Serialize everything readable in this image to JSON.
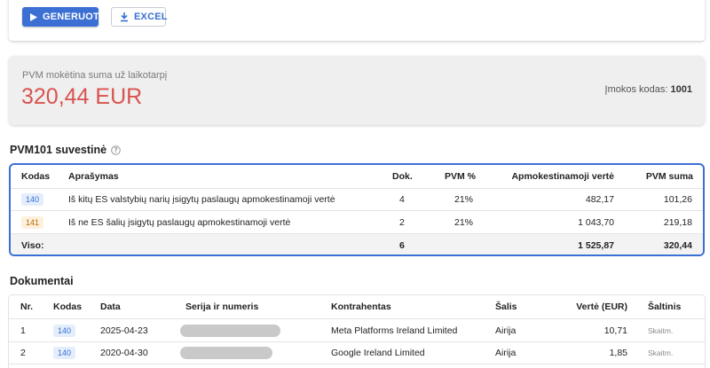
{
  "toolbar": {
    "generate_label": "GENERUOTI",
    "excel_label": "EXCEL",
    "primary_color": "#3b6fd4"
  },
  "summary": {
    "label": "PVM mokėtina suma už laikotarpį",
    "amount": "320,44 EUR",
    "code_label": "Įmokos kodas:",
    "code_value": "1001",
    "amount_color": "#d9534f"
  },
  "pvm101": {
    "title": "PVM101 suvestinė",
    "columns": [
      "Kodas",
      "Aprašymas",
      "Dok.",
      "PVM %",
      "Apmokestinamoji vertė",
      "PVM suma"
    ],
    "rows": [
      {
        "code": "140",
        "description": "Iš kitų ES valstybių narių įsigytų paslaugų apmokestinamoji vertė",
        "docs": "4",
        "vat_rate": "21%",
        "taxable": "482,17",
        "vat": "101,26"
      },
      {
        "code": "141",
        "description": "Iš ne ES šalių įsigytų paslaugų apmokestinamoji vertė",
        "docs": "2",
        "vat_rate": "21%",
        "taxable": "1 043,70",
        "vat": "219,18"
      }
    ],
    "total": {
      "label": "Viso:",
      "docs": "6",
      "taxable": "1 525,87",
      "vat": "320,44"
    }
  },
  "documents": {
    "title": "Dokumentai",
    "columns": [
      "Nr.",
      "Kodas",
      "Data",
      "Serija ir numeris",
      "Kontrahentas",
      "Šalis",
      "Vertė (EUR)",
      "Šaltinis"
    ],
    "rows": [
      {
        "nr": "1",
        "code": "140",
        "date": "2025-04-23",
        "counterparty": "Meta Platforms Ireland Limited",
        "country": "Airija",
        "value": "10,71",
        "source": "Skaitm."
      },
      {
        "nr": "2",
        "code": "140",
        "date": "2020-04-30",
        "counterparty": "Google Ireland Limited",
        "country": "Airija",
        "value": "1,85",
        "source": "Skaitm."
      }
    ]
  }
}
